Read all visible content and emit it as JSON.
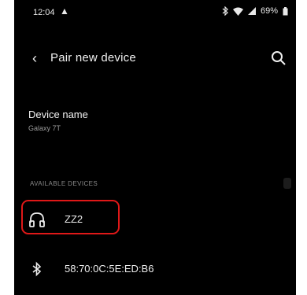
{
  "statusbar": {
    "time": "12:04",
    "upload_icon": "upload-arrow-icon",
    "battery_text": "69%",
    "icons": [
      "bluetooth-icon",
      "wifi-icon",
      "signal-icon",
      "battery-icon"
    ]
  },
  "topbar": {
    "back_icon": "back-arrow-icon",
    "title": "Pair new device",
    "search_icon": "search-icon"
  },
  "device_name": {
    "label": "Device name",
    "value": "Galaxy 7T"
  },
  "available_devices": {
    "header": "AVAILABLE DEVICES",
    "items": [
      {
        "icon": "headphones-icon",
        "name": "ZZ2",
        "highlighted": true
      },
      {
        "icon": "bluetooth-icon",
        "name": "58:70:0C:5E:ED:B6",
        "highlighted": false
      }
    ]
  },
  "colors": {
    "background": "#000000",
    "text_primary": "#f0f0f0",
    "text_secondary": "#9a9a9a",
    "highlight_border": "#e01818"
  }
}
